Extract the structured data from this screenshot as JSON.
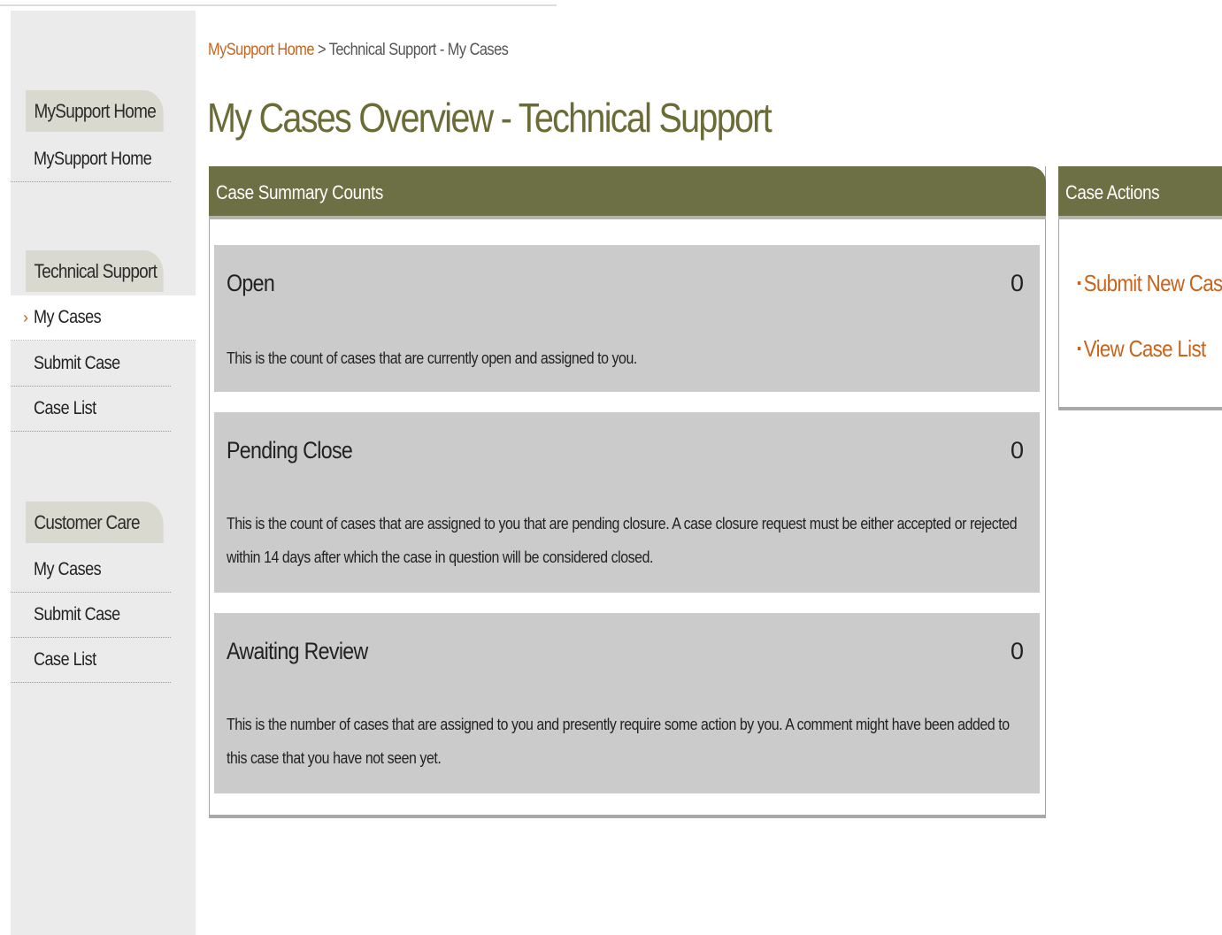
{
  "breadcrumb": {
    "home": "MySupport Home",
    "separator": " > ",
    "current": "Technical Support - My Cases"
  },
  "page_title": "My Cases Overview - Technical Support",
  "sidebar": {
    "sections": [
      {
        "header": "MySupport Home",
        "items": [
          "MySupport Home"
        ]
      },
      {
        "header": "Technical Support",
        "items": [
          "My Cases",
          "Submit Case",
          "Case List"
        ],
        "active_item": "My Cases"
      },
      {
        "header": "Customer Care",
        "items": [
          "My Cases",
          "Submit Case",
          "Case List"
        ]
      }
    ],
    "active_marker": "›"
  },
  "summary": {
    "title": "Case Summary Counts",
    "cards": [
      {
        "title": "Open",
        "count": "0",
        "description": "This is the count of cases that are currently open and assigned to you."
      },
      {
        "title": "Pending Close",
        "count": "0",
        "description": "This is the count of cases that are assigned to you that are pending closure. A case closure request must be either accepted or rejected within 14 days after which the case in question will be considered closed."
      },
      {
        "title": "Awaiting Review",
        "count": "0",
        "description": "This is the number of cases that are assigned to you and presently require some action by you. A comment might have been added to this case that you have not seen yet."
      }
    ]
  },
  "actions": {
    "title": "Case Actions",
    "bullet": "▪",
    "links": [
      "Submit New Case",
      "View Case List"
    ]
  },
  "colors": {
    "accent_olive": "#6d6f45",
    "title_olive": "#6a6b35",
    "link_orange": "#c8641c",
    "card_gray": "#cbcbcb",
    "sidebar_gray": "#ebebeb"
  }
}
